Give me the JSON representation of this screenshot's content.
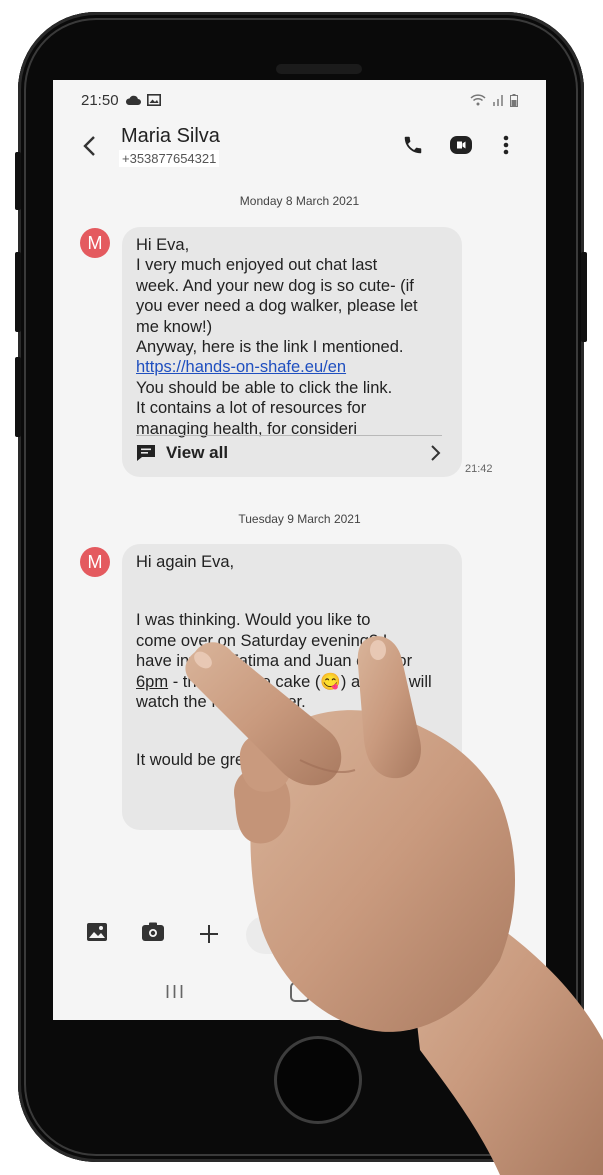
{
  "status_bar": {
    "time": "21:50"
  },
  "header": {
    "back_icon": "chevron-left-icon",
    "contact_name": "Maria Silva",
    "contact_number": "+353877654321",
    "call_icon": "phone-icon",
    "video_icon": "video-call-icon",
    "menu_icon": "more-vertical-icon"
  },
  "conversation": {
    "messages": [
      {
        "date_separator": "Monday 8 March 2021",
        "avatar_letter": "M",
        "lines_before_link": [
          "Hi Eva,",
          "I very much enjoyed out chat last",
          "week. And your new dog is so cute- (if",
          "you ever need a dog walker, please let",
          "me know!)",
          "Anyway, here is the link I mentioned."
        ],
        "link": "https://hands-on-shafe.eu/en",
        "lines_after_link": [
          "You should be able to click the link.",
          "It contains a lot of resources for",
          "managing health, for consideri"
        ],
        "view_all_label": "View all",
        "time": "21:42"
      },
      {
        "date_separator": "Tuesday 9 March 2021",
        "avatar_letter": "M",
        "greeting": "Hi again Eva,",
        "line1": "I was thinking. Would you like to",
        "line2": "come over on Saturday evening? I",
        "line3": "have invited Fatima and Juan over for",
        "line4_time": "6pm",
        "line4_rest": " - there will be cake (😋) and we will",
        "line5": "watch the film together.",
        "line6": "It would be great to see you."
      }
    ]
  },
  "composer": {
    "gallery_icon": "image-icon",
    "camera_icon": "camera-icon",
    "plus_icon": "plus-icon"
  },
  "nav_bar": {
    "recents_label": "III"
  },
  "colors": {
    "avatar": "#e45a5f",
    "bubble": "#e7e7e7",
    "link": "#1f4fbf",
    "screen_bg": "#f5f5f5"
  }
}
